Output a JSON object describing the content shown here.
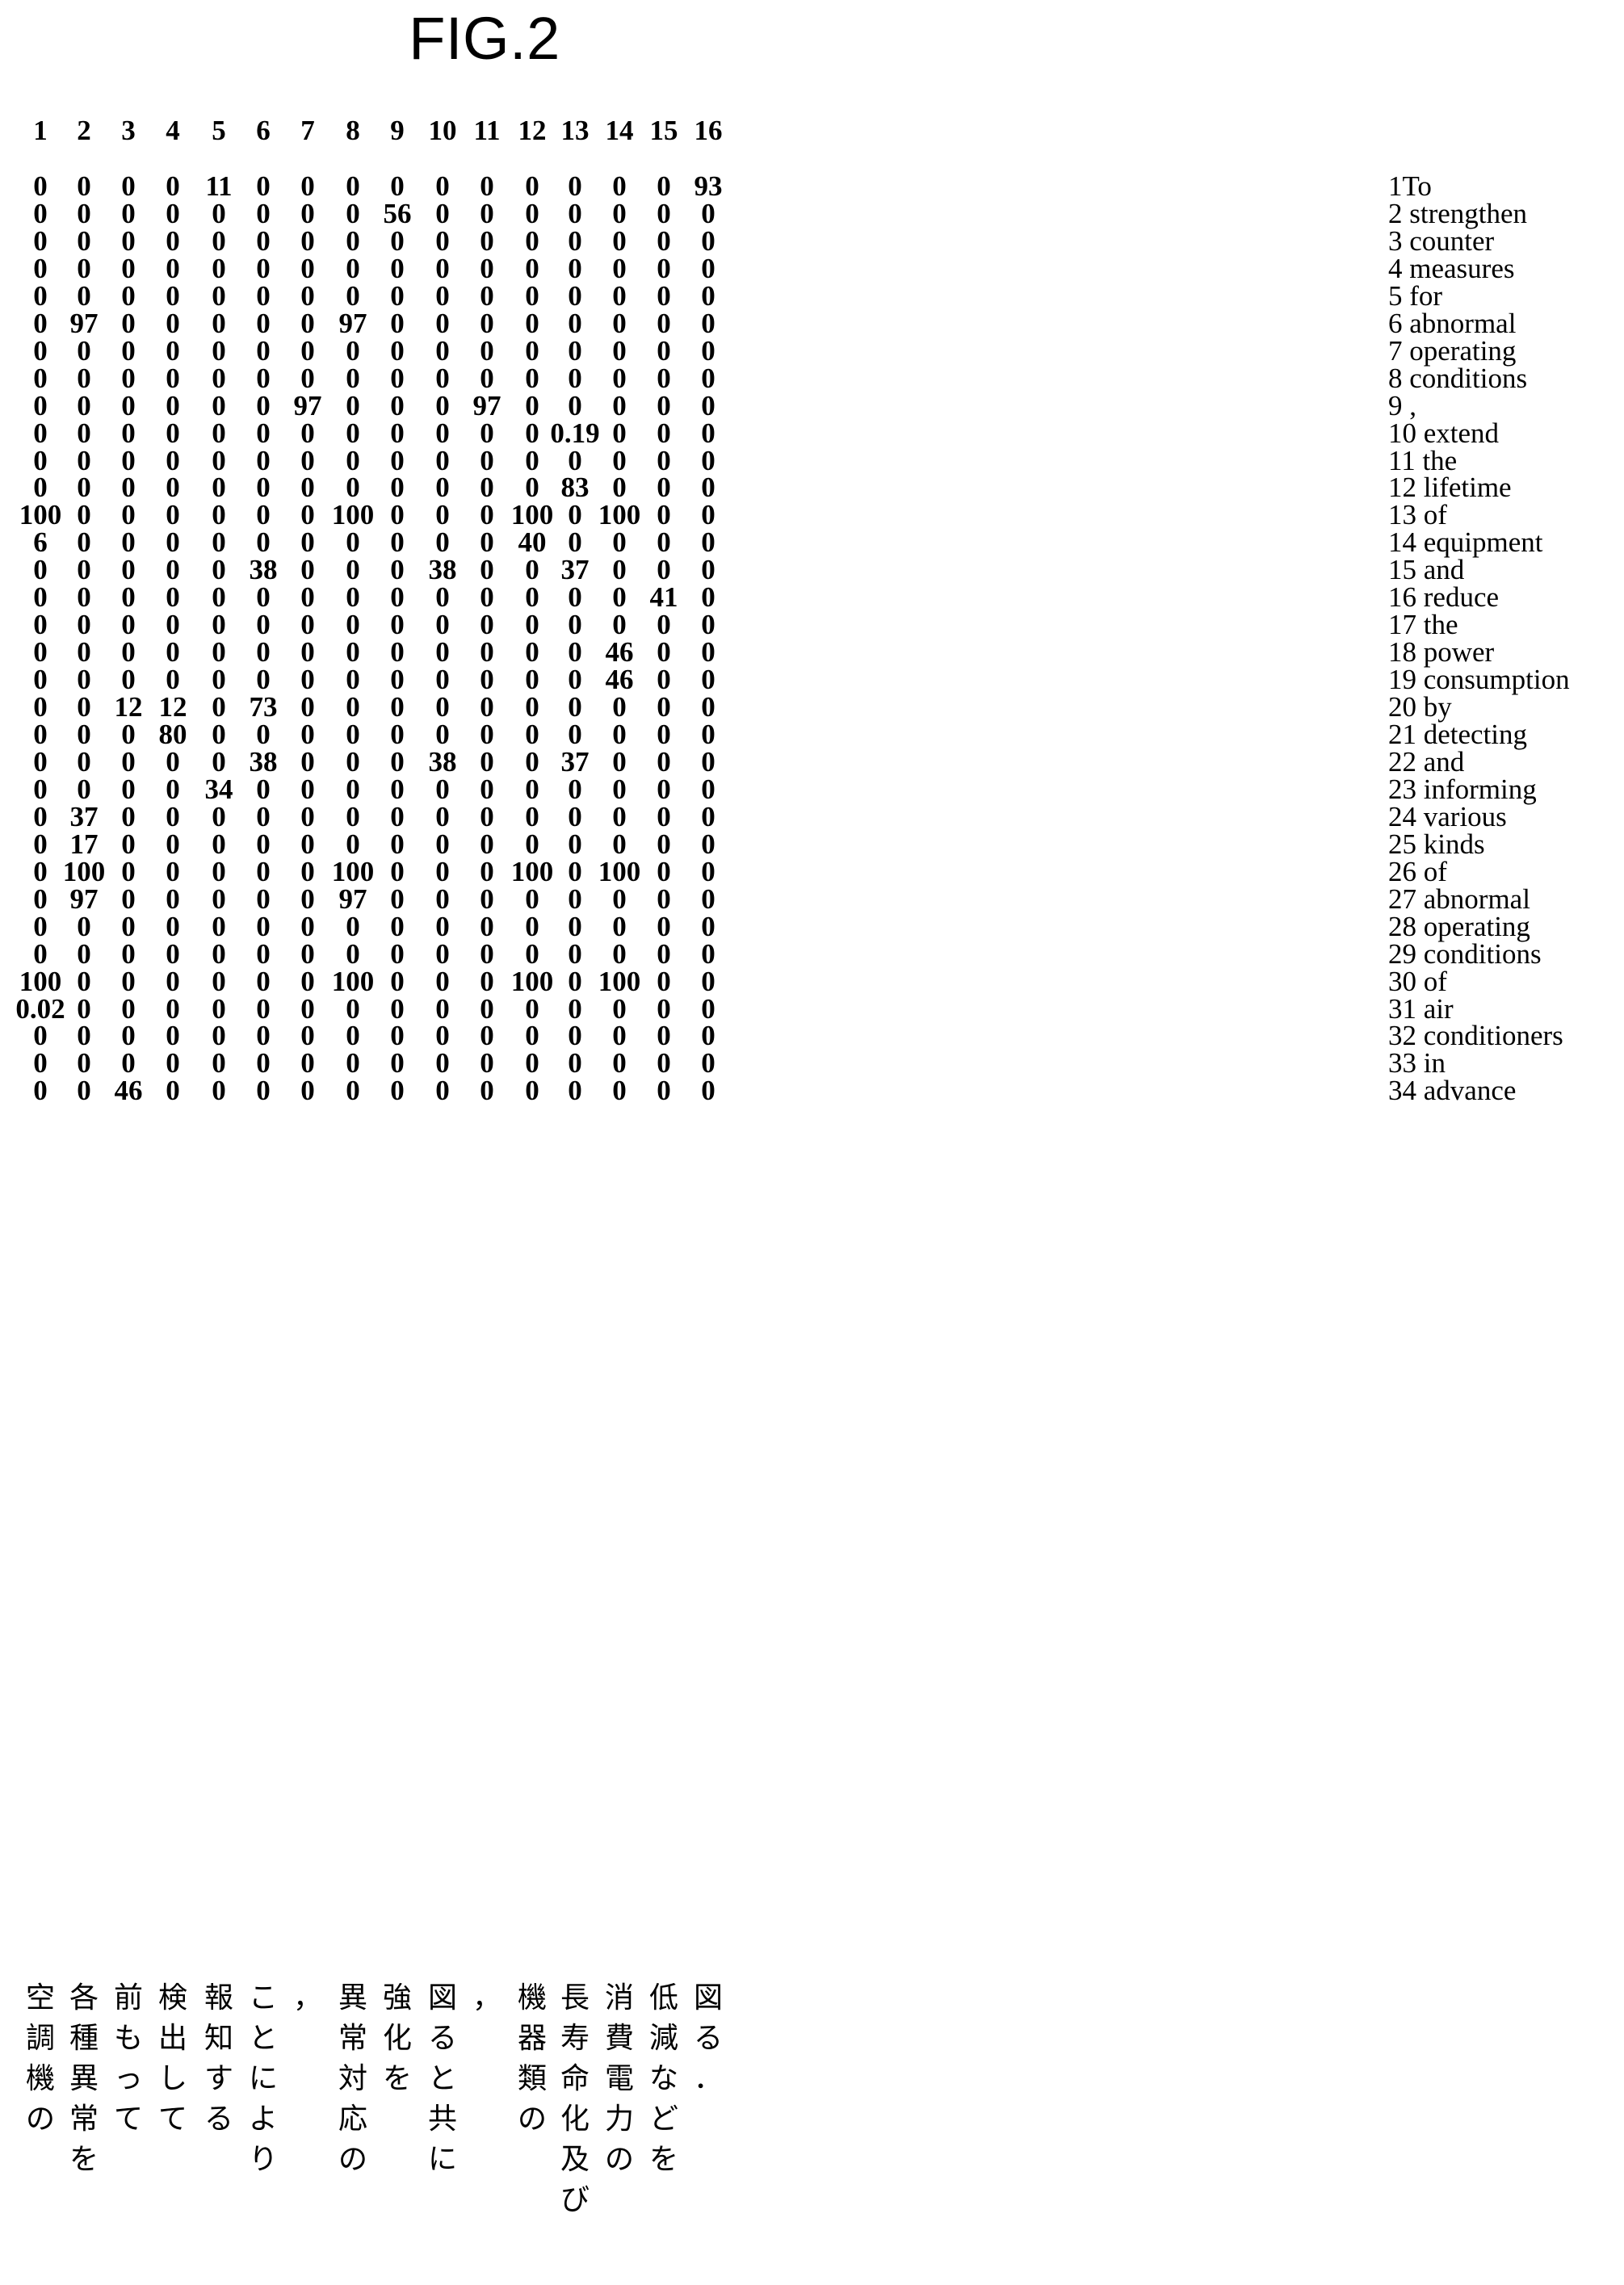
{
  "figure": {
    "title": "FIG.2"
  },
  "matrix": {
    "column_headers": [
      "1",
      "2",
      "3",
      "4",
      "5",
      "6",
      "7",
      "8",
      "9",
      "10",
      "11",
      "12",
      "13",
      "14",
      "15",
      "16"
    ],
    "row_labels": [
      "1To",
      "2 strengthen",
      "3 counter",
      "4 measures",
      "5 for",
      "6 abnormal",
      "7 operating",
      "8 conditions",
      "9 ,",
      "10 extend",
      "11 the",
      "12 lifetime",
      "13 of",
      "14 equipment",
      "15 and",
      "16 reduce",
      "17 the",
      "18 power",
      "19 consumption",
      "20 by",
      "21 detecting",
      "22 and",
      "23 informing",
      "24 various",
      "25 kinds",
      "26 of",
      "27 abnormal",
      "28 operating",
      "29 conditions",
      "30 of",
      "31 air",
      "32 conditioners",
      "33 in",
      "34 advance"
    ],
    "rows": [
      [
        "0",
        "0",
        "0",
        "0",
        "11",
        "0",
        "0",
        "0",
        "0",
        "0",
        "0",
        "0",
        "0",
        "0",
        "0",
        "93"
      ],
      [
        "0",
        "0",
        "0",
        "0",
        "0",
        "0",
        "0",
        "0",
        "56",
        "0",
        "0",
        "0",
        "0",
        "0",
        "0",
        "0"
      ],
      [
        "0",
        "0",
        "0",
        "0",
        "0",
        "0",
        "0",
        "0",
        "0",
        "0",
        "0",
        "0",
        "0",
        "0",
        "0",
        "0"
      ],
      [
        "0",
        "0",
        "0",
        "0",
        "0",
        "0",
        "0",
        "0",
        "0",
        "0",
        "0",
        "0",
        "0",
        "0",
        "0",
        "0"
      ],
      [
        "0",
        "0",
        "0",
        "0",
        "0",
        "0",
        "0",
        "0",
        "0",
        "0",
        "0",
        "0",
        "0",
        "0",
        "0",
        "0"
      ],
      [
        "0",
        "97",
        "0",
        "0",
        "0",
        "0",
        "0",
        "97",
        "0",
        "0",
        "0",
        "0",
        "0",
        "0",
        "0",
        "0"
      ],
      [
        "0",
        "0",
        "0",
        "0",
        "0",
        "0",
        "0",
        "0",
        "0",
        "0",
        "0",
        "0",
        "0",
        "0",
        "0",
        "0"
      ],
      [
        "0",
        "0",
        "0",
        "0",
        "0",
        "0",
        "0",
        "0",
        "0",
        "0",
        "0",
        "0",
        "0",
        "0",
        "0",
        "0"
      ],
      [
        "0",
        "0",
        "0",
        "0",
        "0",
        "0",
        "97",
        "0",
        "0",
        "0",
        "97",
        "0",
        "0",
        "0",
        "0",
        "0"
      ],
      [
        "0",
        "0",
        "0",
        "0",
        "0",
        "0",
        "0",
        "0",
        "0",
        "0",
        "0",
        "0",
        "0.19",
        "0",
        "0",
        "0"
      ],
      [
        "0",
        "0",
        "0",
        "0",
        "0",
        "0",
        "0",
        "0",
        "0",
        "0",
        "0",
        "0",
        "0",
        "0",
        "0",
        "0"
      ],
      [
        "0",
        "0",
        "0",
        "0",
        "0",
        "0",
        "0",
        "0",
        "0",
        "0",
        "0",
        "0",
        "83",
        "0",
        "0",
        "0"
      ],
      [
        "100",
        "0",
        "0",
        "0",
        "0",
        "0",
        "0",
        "100",
        "0",
        "0",
        "0",
        "100",
        "0",
        "100",
        "0",
        "0"
      ],
      [
        "6",
        "0",
        "0",
        "0",
        "0",
        "0",
        "0",
        "0",
        "0",
        "0",
        "0",
        "40",
        "0",
        "0",
        "0",
        "0"
      ],
      [
        "0",
        "0",
        "0",
        "0",
        "0",
        "38",
        "0",
        "0",
        "0",
        "38",
        "0",
        "0",
        "37",
        "0",
        "0",
        "0"
      ],
      [
        "0",
        "0",
        "0",
        "0",
        "0",
        "0",
        "0",
        "0",
        "0",
        "0",
        "0",
        "0",
        "0",
        "0",
        "41",
        "0"
      ],
      [
        "0",
        "0",
        "0",
        "0",
        "0",
        "0",
        "0",
        "0",
        "0",
        "0",
        "0",
        "0",
        "0",
        "0",
        "0",
        "0"
      ],
      [
        "0",
        "0",
        "0",
        "0",
        "0",
        "0",
        "0",
        "0",
        "0",
        "0",
        "0",
        "0",
        "0",
        "46",
        "0",
        "0"
      ],
      [
        "0",
        "0",
        "0",
        "0",
        "0",
        "0",
        "0",
        "0",
        "0",
        "0",
        "0",
        "0",
        "0",
        "46",
        "0",
        "0"
      ],
      [
        "0",
        "0",
        "12",
        "12",
        "0",
        "73",
        "0",
        "0",
        "0",
        "0",
        "0",
        "0",
        "0",
        "0",
        "0",
        "0"
      ],
      [
        "0",
        "0",
        "0",
        "80",
        "0",
        "0",
        "0",
        "0",
        "0",
        "0",
        "0",
        "0",
        "0",
        "0",
        "0",
        "0"
      ],
      [
        "0",
        "0",
        "0",
        "0",
        "0",
        "38",
        "0",
        "0",
        "0",
        "38",
        "0",
        "0",
        "37",
        "0",
        "0",
        "0"
      ],
      [
        "0",
        "0",
        "0",
        "0",
        "34",
        "0",
        "0",
        "0",
        "0",
        "0",
        "0",
        "0",
        "0",
        "0",
        "0",
        "0"
      ],
      [
        "0",
        "37",
        "0",
        "0",
        "0",
        "0",
        "0",
        "0",
        "0",
        "0",
        "0",
        "0",
        "0",
        "0",
        "0",
        "0"
      ],
      [
        "0",
        "17",
        "0",
        "0",
        "0",
        "0",
        "0",
        "0",
        "0",
        "0",
        "0",
        "0",
        "0",
        "0",
        "0",
        "0"
      ],
      [
        "0",
        "100",
        "0",
        "0",
        "0",
        "0",
        "0",
        "100",
        "0",
        "0",
        "0",
        "100",
        "0",
        "100",
        "0",
        "0"
      ],
      [
        "0",
        "97",
        "0",
        "0",
        "0",
        "0",
        "0",
        "97",
        "0",
        "0",
        "0",
        "0",
        "0",
        "0",
        "0",
        "0"
      ],
      [
        "0",
        "0",
        "0",
        "0",
        "0",
        "0",
        "0",
        "0",
        "0",
        "0",
        "0",
        "0",
        "0",
        "0",
        "0",
        "0"
      ],
      [
        "0",
        "0",
        "0",
        "0",
        "0",
        "0",
        "0",
        "0",
        "0",
        "0",
        "0",
        "0",
        "0",
        "0",
        "0",
        "0"
      ],
      [
        "100",
        "0",
        "0",
        "0",
        "0",
        "0",
        "0",
        "100",
        "0",
        "0",
        "0",
        "100",
        "0",
        "100",
        "0",
        "0"
      ],
      [
        "0.02",
        "0",
        "0",
        "0",
        "0",
        "0",
        "0",
        "0",
        "0",
        "0",
        "0",
        "0",
        "0",
        "0",
        "0",
        "0"
      ],
      [
        "0",
        "0",
        "0",
        "0",
        "0",
        "0",
        "0",
        "0",
        "0",
        "0",
        "0",
        "0",
        "0",
        "0",
        "0",
        "0"
      ],
      [
        "0",
        "0",
        "0",
        "0",
        "0",
        "0",
        "0",
        "0",
        "0",
        "0",
        "0",
        "0",
        "0",
        "0",
        "0",
        "0"
      ],
      [
        "0",
        "0",
        "46",
        "0",
        "0",
        "0",
        "0",
        "0",
        "0",
        "0",
        "0",
        "0",
        "0",
        "0",
        "0",
        "0"
      ]
    ],
    "japanese_columns": [
      "空調機の",
      "各種異常を",
      "前もって",
      "検出して",
      "報知する",
      "ことにより",
      "，",
      "異常対応の",
      "強化を",
      "図ると共に",
      "，",
      "機器類の",
      "長寿命化及び",
      "消費電力の",
      "低減などを",
      "図る．"
    ]
  },
  "chart_data": {
    "type": "heatmap",
    "title": "FIG.2",
    "xlabel": "",
    "ylabel": "",
    "grid": false,
    "legend": "none",
    "x": [
      "1",
      "2",
      "3",
      "4",
      "5",
      "6",
      "7",
      "8",
      "9",
      "10",
      "11",
      "12",
      "13",
      "14",
      "15",
      "16"
    ],
    "y": [
      "1To",
      "2 strengthen",
      "3 counter",
      "4 measures",
      "5 for",
      "6 abnormal",
      "7 operating",
      "8 conditions",
      "9 ,",
      "10 extend",
      "11 the",
      "12 lifetime",
      "13 of",
      "14 equipment",
      "15 and",
      "16 reduce",
      "17 the",
      "18 power",
      "19 consumption",
      "20 by",
      "21 detecting",
      "22 and",
      "23 informing",
      "24 various",
      "25 kinds",
      "26 of",
      "27 abnormal",
      "28 operating",
      "29 conditions",
      "30 of",
      "31 air",
      "32 conditioners",
      "33 in",
      "34 advance"
    ],
    "values": [
      [
        0,
        0,
        0,
        0,
        11,
        0,
        0,
        0,
        0,
        0,
        0,
        0,
        0,
        0,
        0,
        93
      ],
      [
        0,
        0,
        0,
        0,
        0,
        0,
        0,
        0,
        56,
        0,
        0,
        0,
        0,
        0,
        0,
        0
      ],
      [
        0,
        0,
        0,
        0,
        0,
        0,
        0,
        0,
        0,
        0,
        0,
        0,
        0,
        0,
        0,
        0
      ],
      [
        0,
        0,
        0,
        0,
        0,
        0,
        0,
        0,
        0,
        0,
        0,
        0,
        0,
        0,
        0,
        0
      ],
      [
        0,
        0,
        0,
        0,
        0,
        0,
        0,
        0,
        0,
        0,
        0,
        0,
        0,
        0,
        0,
        0
      ],
      [
        0,
        97,
        0,
        0,
        0,
        0,
        0,
        97,
        0,
        0,
        0,
        0,
        0,
        0,
        0,
        0
      ],
      [
        0,
        0,
        0,
        0,
        0,
        0,
        0,
        0,
        0,
        0,
        0,
        0,
        0,
        0,
        0,
        0
      ],
      [
        0,
        0,
        0,
        0,
        0,
        0,
        0,
        0,
        0,
        0,
        0,
        0,
        0,
        0,
        0,
        0
      ],
      [
        0,
        0,
        0,
        0,
        0,
        0,
        97,
        0,
        0,
        0,
        97,
        0,
        0,
        0,
        0,
        0
      ],
      [
        0,
        0,
        0,
        0,
        0,
        0,
        0,
        0,
        0,
        0,
        0,
        0,
        0.19,
        0,
        0,
        0
      ],
      [
        0,
        0,
        0,
        0,
        0,
        0,
        0,
        0,
        0,
        0,
        0,
        0,
        0,
        0,
        0,
        0
      ],
      [
        0,
        0,
        0,
        0,
        0,
        0,
        0,
        0,
        0,
        0,
        0,
        0,
        83,
        0,
        0,
        0
      ],
      [
        100,
        0,
        0,
        0,
        0,
        0,
        0,
        100,
        0,
        0,
        0,
        100,
        0,
        100,
        0,
        0
      ],
      [
        6,
        0,
        0,
        0,
        0,
        0,
        0,
        0,
        0,
        0,
        0,
        40,
        0,
        0,
        0,
        0
      ],
      [
        0,
        0,
        0,
        0,
        0,
        38,
        0,
        0,
        0,
        38,
        0,
        0,
        37,
        0,
        0,
        0
      ],
      [
        0,
        0,
        0,
        0,
        0,
        0,
        0,
        0,
        0,
        0,
        0,
        0,
        0,
        0,
        41,
        0
      ],
      [
        0,
        0,
        0,
        0,
        0,
        0,
        0,
        0,
        0,
        0,
        0,
        0,
        0,
        0,
        0,
        0
      ],
      [
        0,
        0,
        0,
        0,
        0,
        0,
        0,
        0,
        0,
        0,
        0,
        0,
        0,
        46,
        0,
        0
      ],
      [
        0,
        0,
        0,
        0,
        0,
        0,
        0,
        0,
        0,
        0,
        0,
        0,
        0,
        46,
        0,
        0
      ],
      [
        0,
        0,
        12,
        12,
        0,
        73,
        0,
        0,
        0,
        0,
        0,
        0,
        0,
        0,
        0,
        0
      ],
      [
        0,
        0,
        0,
        80,
        0,
        0,
        0,
        0,
        0,
        0,
        0,
        0,
        0,
        0,
        0,
        0
      ],
      [
        0,
        0,
        0,
        0,
        0,
        38,
        0,
        0,
        0,
        38,
        0,
        0,
        37,
        0,
        0,
        0
      ],
      [
        0,
        0,
        0,
        0,
        34,
        0,
        0,
        0,
        0,
        0,
        0,
        0,
        0,
        0,
        0,
        0
      ],
      [
        0,
        37,
        0,
        0,
        0,
        0,
        0,
        0,
        0,
        0,
        0,
        0,
        0,
        0,
        0,
        0
      ],
      [
        0,
        17,
        0,
        0,
        0,
        0,
        0,
        0,
        0,
        0,
        0,
        0,
        0,
        0,
        0,
        0
      ],
      [
        0,
        100,
        0,
        0,
        0,
        0,
        0,
        100,
        0,
        0,
        0,
        100,
        0,
        100,
        0,
        0
      ],
      [
        0,
        97,
        0,
        0,
        0,
        0,
        0,
        97,
        0,
        0,
        0,
        0,
        0,
        0,
        0,
        0
      ],
      [
        0,
        0,
        0,
        0,
        0,
        0,
        0,
        0,
        0,
        0,
        0,
        0,
        0,
        0,
        0,
        0
      ],
      [
        0,
        0,
        0,
        0,
        0,
        0,
        0,
        0,
        0,
        0,
        0,
        0,
        0,
        0,
        0,
        0
      ],
      [
        100,
        0,
        0,
        0,
        0,
        0,
        0,
        100,
        0,
        0,
        0,
        100,
        0,
        100,
        0,
        0
      ],
      [
        0.02,
        0,
        0,
        0,
        0,
        0,
        0,
        0,
        0,
        0,
        0,
        0,
        0,
        0,
        0,
        0
      ],
      [
        0,
        0,
        0,
        0,
        0,
        0,
        0,
        0,
        0,
        0,
        0,
        0,
        0,
        0,
        0,
        0
      ],
      [
        0,
        0,
        0,
        0,
        0,
        0,
        0,
        0,
        0,
        0,
        0,
        0,
        0,
        0,
        0,
        0
      ],
      [
        0,
        0,
        46,
        0,
        0,
        0,
        0,
        0,
        0,
        0,
        0,
        0,
        0,
        0,
        0,
        0
      ]
    ]
  }
}
